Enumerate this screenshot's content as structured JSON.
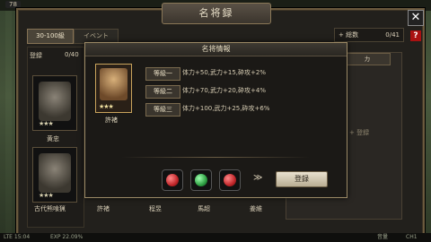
{
  "top": {
    "level": "78"
  },
  "window": {
    "title": "名将録",
    "close": "✕",
    "help": "?"
  },
  "tabs": [
    {
      "label": "30-100級"
    },
    {
      "label": "イベント"
    }
  ],
  "counter": {
    "label": "+ 総数",
    "value": "0/41"
  },
  "left": {
    "register_label": "登録",
    "register_count": "0/40"
  },
  "cards": [
    {
      "name": "黄忠",
      "stars": "★★★"
    },
    {
      "name": "",
      "stars": "★★★"
    }
  ],
  "bottom_names": [
    "古代熊喰猟",
    "許褚",
    "程昱",
    "馬超",
    "姜維"
  ],
  "right": {
    "pill": "カ",
    "text": "+ 登録"
  },
  "modal": {
    "title": "名将情報",
    "hero_name": "許褚",
    "hero_stars": "★★★",
    "grades": [
      {
        "label": "等級一",
        "stat": "体力+50,武力+15,砕攻+2%"
      },
      {
        "label": "等級二",
        "stat": "体力+70,武力+20,砕攻+4%"
      },
      {
        "label": "等級三",
        "stat": "体力+100,武力+25,砕攻+6%"
      }
    ],
    "arrows": "≫",
    "register_button": "登録",
    "gems": [
      {
        "color": "#c0262a"
      },
      {
        "color": "#2ea043"
      },
      {
        "color": "#c0262a"
      }
    ]
  },
  "status": {
    "left": "LTE 15:04",
    "exp": "EXP 22.09%",
    "right1": "音量",
    "right2": "CH1"
  }
}
